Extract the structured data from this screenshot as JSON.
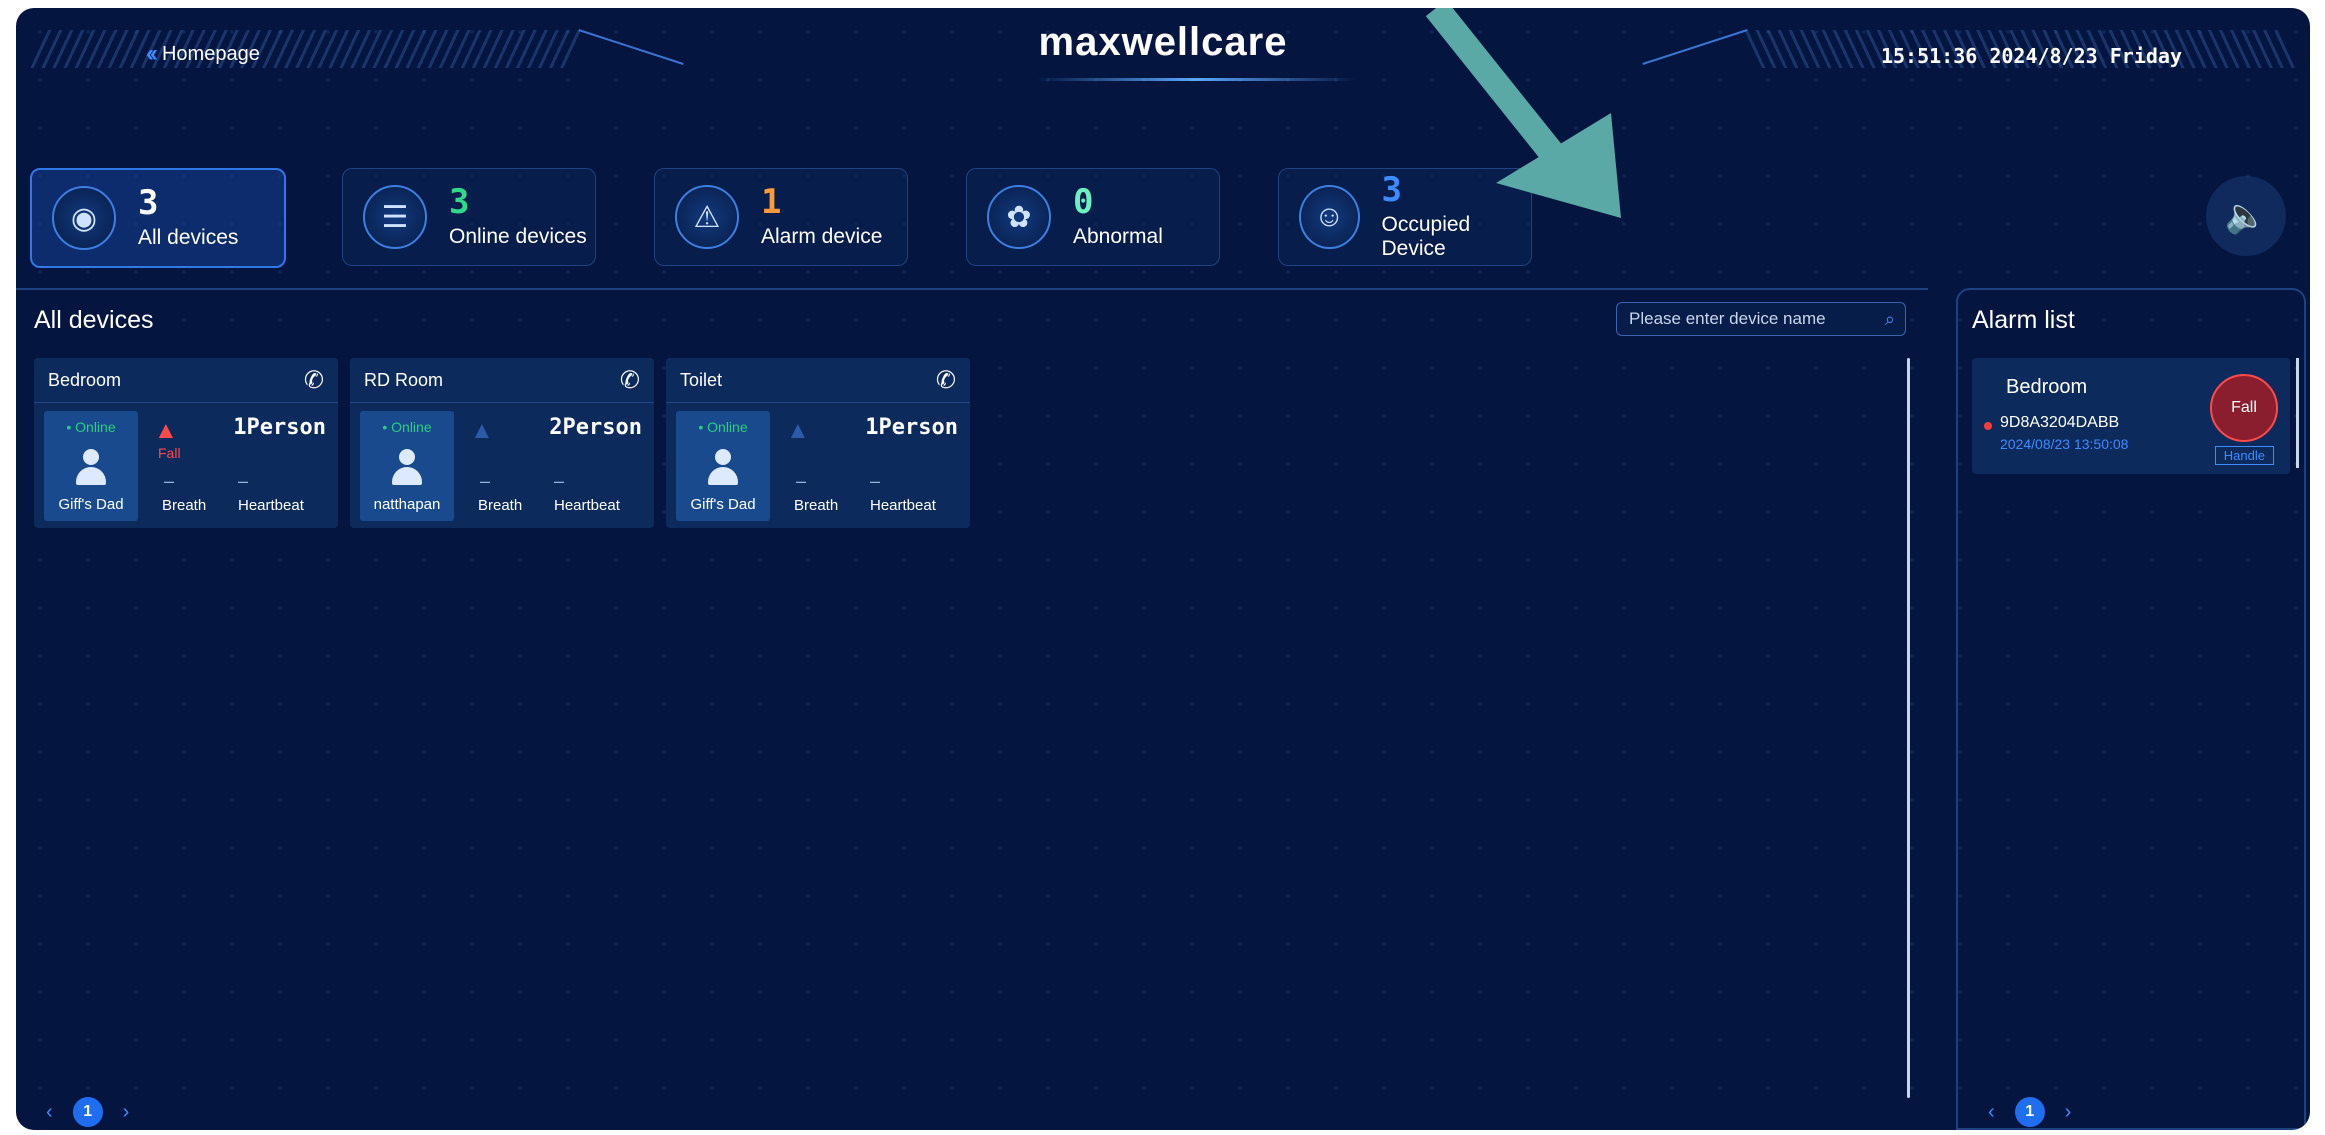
{
  "header": {
    "back_label": "Homepage",
    "brand": "maxwellcare",
    "datetime": "15:51:36 2024/8/23 Friday"
  },
  "stats": [
    {
      "value": "3",
      "label": "All devices",
      "icon": "radar-icon",
      "color": "#ffffff"
    },
    {
      "value": "3",
      "label": "Online devices",
      "icon": "wifi-icon",
      "color": "#2fd98a"
    },
    {
      "value": "1",
      "label": "Alarm device",
      "icon": "warning-icon",
      "color": "#ff9a3c"
    },
    {
      "value": "0",
      "label": "Abnormal",
      "icon": "lungs-icon",
      "color": "#6cf0c0"
    },
    {
      "value": "3",
      "label": "Occupied Device",
      "icon": "person-icon",
      "color": "#3c8cff"
    }
  ],
  "devices_panel": {
    "title": "All devices",
    "search_placeholder": "Please enter device name"
  },
  "devices": [
    {
      "room": "Bedroom",
      "status": "• Online",
      "user": "Giff's Dad",
      "alarm": "Fall",
      "count": "1Person",
      "breath_value": "–",
      "heartbeat_value": "–",
      "breath_label": "Breath",
      "heartbeat_label": "Heartbeat"
    },
    {
      "room": "RD Room",
      "status": "• Online",
      "user": "natthapan",
      "alarm": "",
      "count": "2Person",
      "breath_value": "–",
      "heartbeat_value": "–",
      "breath_label": "Breath",
      "heartbeat_label": "Heartbeat"
    },
    {
      "room": "Toilet",
      "status": "• Online",
      "user": "Giff's Dad",
      "alarm": "",
      "count": "1Person",
      "breath_value": "–",
      "heartbeat_value": "–",
      "breath_label": "Breath",
      "heartbeat_label": "Heartbeat"
    }
  ],
  "alarm_panel": {
    "title": "Alarm list",
    "items": [
      {
        "room": "Bedroom",
        "device_id": "9D8A3204DABB",
        "time": "2024/08/23 13:50:08",
        "type": "Fall",
        "action": "Handle"
      }
    ]
  },
  "pagination": {
    "prev": "‹",
    "page": "1",
    "next": "›"
  },
  "colors": {
    "accent": "#1f6ef0",
    "online": "#26d07c",
    "alarm": "#ff4a4a",
    "arrow": "#5aa9a6"
  }
}
